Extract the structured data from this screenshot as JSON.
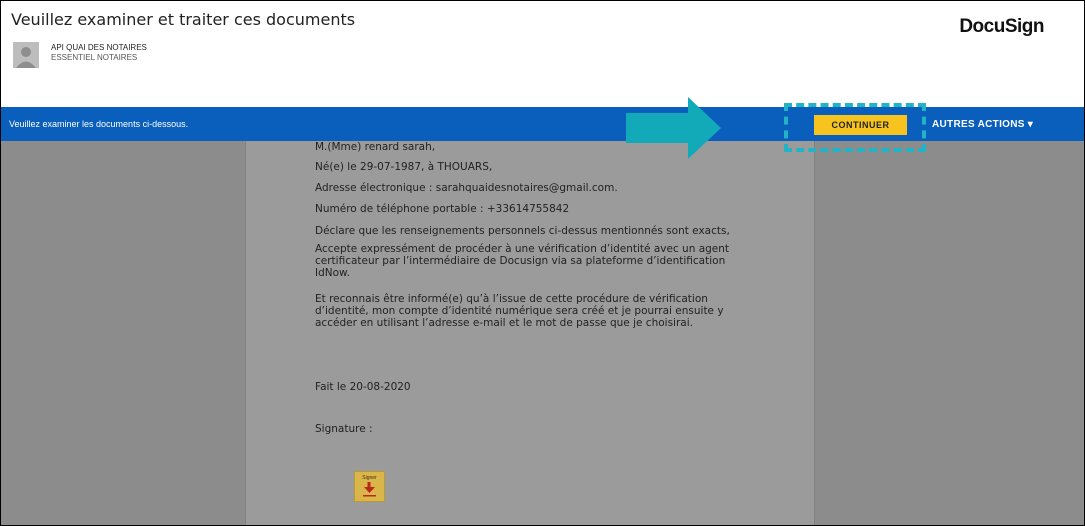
{
  "header": {
    "title": "Veuillez examiner et traiter ces documents",
    "sender_name": "API QUAI DES NOTAIRES",
    "sender_org": "ESSENTIEL NOTAIRES",
    "logo": "DocuSign"
  },
  "toolbar": {
    "instruction": "Veuillez examiner les documents ci-dessous.",
    "continue_label": "CONTINUER",
    "other_actions_label": "AUTRES ACTIONS ▾"
  },
  "document": {
    "line1": "M.(Mme) renard sarah,",
    "line2": "Né(e) le 29-07-1987, à THOUARS,",
    "line3": "Adresse électronique : sarahquaidesnotaires@gmail.com.",
    "line4": "Numéro de téléphone portable : +33614755842",
    "line5": "Déclare que les renseignements personnels ci-dessus mentionnés sont exacts,",
    "line6": "Accepte expressément de procéder à une vérification d’identité avec un agent\ncertificateur par l’intermédiaire de Docusign via sa plateforme d’identification\nIdNow.",
    "line7": " Et reconnais être informé(e) qu’à l’issue de cette procédure de vérification\nd’identité, mon compte d’identité numérique sera créé et je pourrai ensuite y\naccéder en utilisant l’adresse e-mail et le mot de passe que je choisirai.",
    "fait_le": "Fait le  20-08-2020",
    "signature_label": "Signature :",
    "sign_button_label": "Signer"
  },
  "colors": {
    "bar": "#0a5fbc",
    "continue_button": "#f7c41f",
    "highlight": "#22b4c6",
    "arrow": "#12a9b9"
  }
}
